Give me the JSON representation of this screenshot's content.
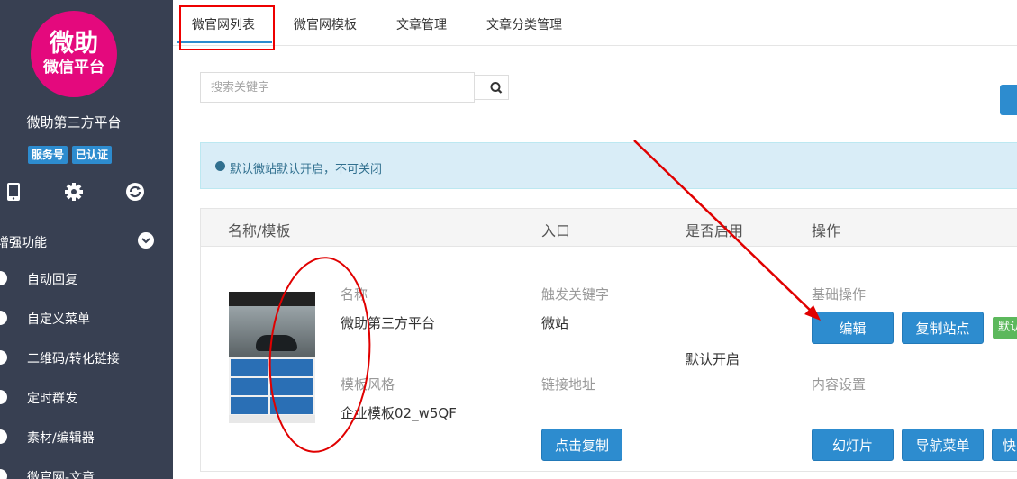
{
  "sidebar": {
    "logo_line1": "微助",
    "logo_line2": "微信平台",
    "account_name": "微助第三方平台",
    "badges": [
      "服务号",
      "已认证"
    ],
    "icons": [
      "mobile-icon",
      "gear-icon",
      "refresh-icon"
    ],
    "section_title": "增强功能",
    "menu": [
      {
        "label": "自动回复",
        "icon": "reply-icon"
      },
      {
        "label": "自定义菜单",
        "icon": "menu-icon"
      },
      {
        "label": "二维码/转化链接",
        "icon": "qrcode-icon"
      },
      {
        "label": "定时群发",
        "icon": "clock-icon"
      },
      {
        "label": "素材/编辑器",
        "icon": "edit-icon"
      },
      {
        "label": "微官网-文章",
        "icon": "article-icon"
      }
    ]
  },
  "tabs": [
    "微官网列表",
    "微官网模板",
    "文章管理",
    "文章分类管理"
  ],
  "active_tab": "微官网列表",
  "search": {
    "placeholder": "搜索关键字"
  },
  "alert": "默认微站默认开启，不可关闭",
  "table": {
    "headers": [
      "名称/模板",
      "入口",
      "是否启用",
      "操作"
    ],
    "row": {
      "name_label": "名称",
      "name_value": "微助第三方平台",
      "template_label": "模板风格",
      "template_value": "企业模板02_w5QF",
      "trigger_label": "触发关键字",
      "trigger_value": "微站",
      "link_label": "链接地址",
      "copy_button": "点击复制",
      "enabled_value": "默认开启",
      "basic_ops_label": "基础操作",
      "edit_button": "编辑",
      "copy_site_button": "复制站点",
      "default_badge": "默认",
      "content_label": "内容设置",
      "slides_button": "幻灯片",
      "nav_button": "导航菜单",
      "quick_button": "快"
    }
  },
  "colors": {
    "sidebar_bg": "#384052",
    "logo": "#e4097d",
    "primary": "#2d8ccf",
    "alert_bg": "#d9edf7",
    "annotation": "#e00000",
    "success": "#5cb85c"
  }
}
